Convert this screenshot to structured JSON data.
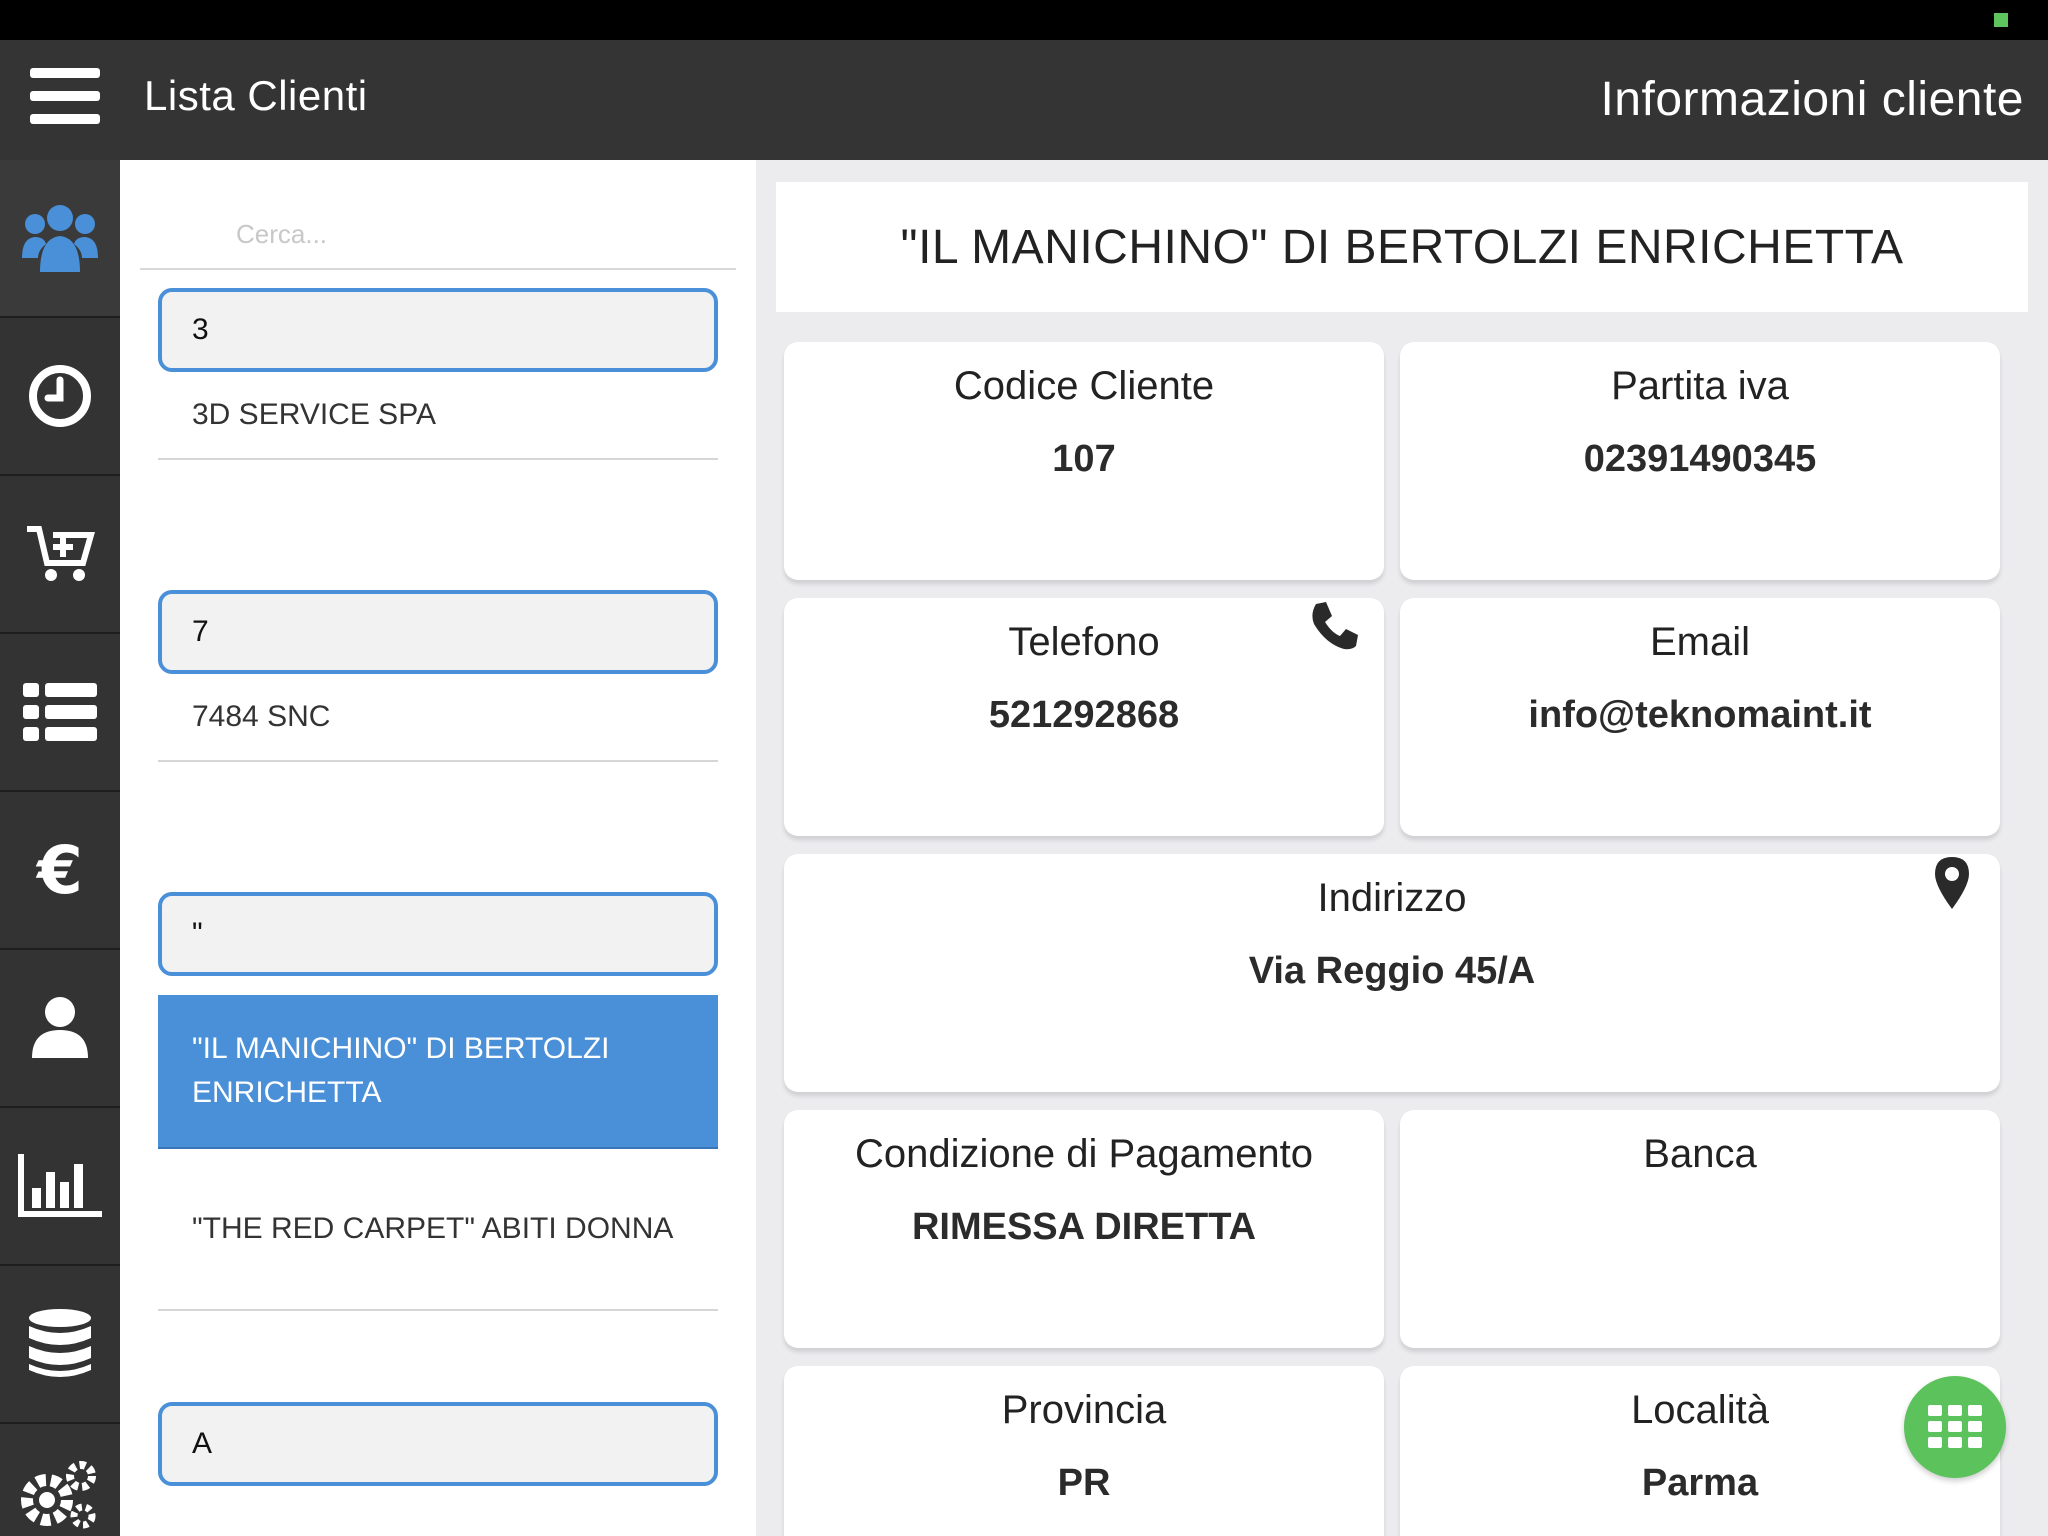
{
  "header": {
    "left_title": "Lista Clienti",
    "right_title": "Informazioni cliente"
  },
  "sidebar": {
    "items": [
      {
        "icon": "users-icon",
        "active": true
      },
      {
        "icon": "clock-icon",
        "active": false
      },
      {
        "icon": "cart-add-icon",
        "active": false
      },
      {
        "icon": "list-icon",
        "active": false
      },
      {
        "icon": "euro-icon",
        "active": false
      },
      {
        "icon": "user-icon",
        "active": false
      },
      {
        "icon": "bar-chart-icon",
        "active": false
      },
      {
        "icon": "database-icon",
        "active": false
      },
      {
        "icon": "gears-icon",
        "active": false
      }
    ]
  },
  "search": {
    "placeholder": "Cerca..."
  },
  "client_list": {
    "groups": [
      {
        "header": "3",
        "clients": [
          "3D SERVICE SPA"
        ]
      },
      {
        "header": "7",
        "clients": [
          "7484 SNC"
        ]
      },
      {
        "header": "\"",
        "clients": [
          "\"IL MANICHINO\" DI BERTOLZI ENRICHETTA",
          "\"THE RED CARPET\" ABITI DONNA"
        ]
      },
      {
        "header": "A",
        "clients": []
      }
    ],
    "selected": "\"IL MANICHINO\" DI BERTOLZI ENRICHETTA"
  },
  "client": {
    "name": "\"IL MANICHINO\" DI BERTOLZI ENRICHETTA",
    "codice_label": "Codice Cliente",
    "codice": "107",
    "piva_label": "Partita iva",
    "piva": "02391490345",
    "telefono_label": "Telefono",
    "telefono": "521292868",
    "email_label": "Email",
    "email": "info@teknomaint.it",
    "indirizzo_label": "Indirizzo",
    "indirizzo": "Via Reggio 45/A",
    "pagamento_label": "Condizione di Pagamento",
    "pagamento": "RIMESSA DIRETTA",
    "banca_label": "Banca",
    "banca": "",
    "provincia_label": "Provincia",
    "provincia": "PR",
    "localita_label": "Località",
    "localita": "Parma"
  },
  "colors": {
    "accent": "#4a90d9",
    "topbar": "#343434",
    "fab": "#5cc25c",
    "active_icon": "#4a90d9"
  }
}
